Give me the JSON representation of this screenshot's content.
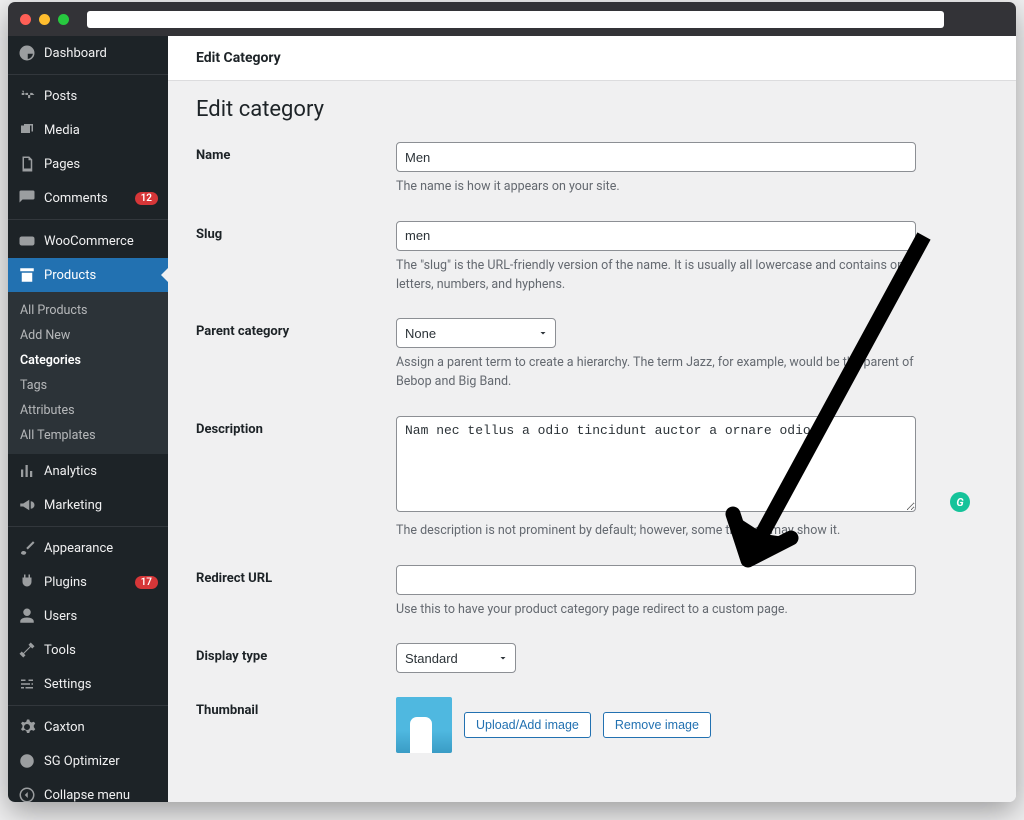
{
  "sidebar": {
    "items": [
      {
        "icon": "dashboard",
        "label": "Dashboard"
      },
      {
        "icon": "pin",
        "label": "Posts"
      },
      {
        "icon": "media",
        "label": "Media"
      },
      {
        "icon": "page",
        "label": "Pages"
      },
      {
        "icon": "comment",
        "label": "Comments",
        "badge": "12"
      },
      {
        "icon": "woo",
        "label": "WooCommerce"
      },
      {
        "icon": "archive",
        "label": "Products",
        "active": true
      },
      {
        "icon": "chart",
        "label": "Analytics"
      },
      {
        "icon": "megaphone",
        "label": "Marketing"
      },
      {
        "icon": "brush",
        "label": "Appearance"
      },
      {
        "icon": "plug",
        "label": "Plugins",
        "badge": "17"
      },
      {
        "icon": "user",
        "label": "Users"
      },
      {
        "icon": "wrench",
        "label": "Tools"
      },
      {
        "icon": "settings",
        "label": "Settings"
      },
      {
        "icon": "gear",
        "label": "Caxton"
      },
      {
        "icon": "sg",
        "label": "SG Optimizer"
      },
      {
        "icon": "collapse",
        "label": "Collapse menu"
      }
    ],
    "sub": [
      {
        "label": "All Products"
      },
      {
        "label": "Add New"
      },
      {
        "label": "Categories",
        "current": true
      },
      {
        "label": "Tags"
      },
      {
        "label": "Attributes"
      },
      {
        "label": "All Templates"
      }
    ]
  },
  "header": {
    "title": "Edit Category"
  },
  "form": {
    "title": "Edit category",
    "name": {
      "label": "Name",
      "value": "Men",
      "helper": "The name is how it appears on your site."
    },
    "slug": {
      "label": "Slug",
      "value": "men",
      "helper": "The \"slug\" is the URL-friendly version of the name. It is usually all lowercase and contains only letters, numbers, and hyphens."
    },
    "parent": {
      "label": "Parent category",
      "value": "None",
      "helper": "Assign a parent term to create a hierarchy. The term Jazz, for example, would be the parent of Bebop and Big Band."
    },
    "description": {
      "label": "Description",
      "value": "Nam nec tellus a odio tincidunt auctor a ornare odio.",
      "helper": "The description is not prominent by default; however, some themes may show it."
    },
    "redirect": {
      "label": "Redirect URL",
      "value": "",
      "helper": "Use this to have your product category page redirect to a custom page."
    },
    "display": {
      "label": "Display type",
      "value": "Standard"
    },
    "thumbnail": {
      "label": "Thumbnail",
      "upload_btn": "Upload/Add image",
      "remove_btn": "Remove image"
    }
  },
  "grammarly": "G"
}
